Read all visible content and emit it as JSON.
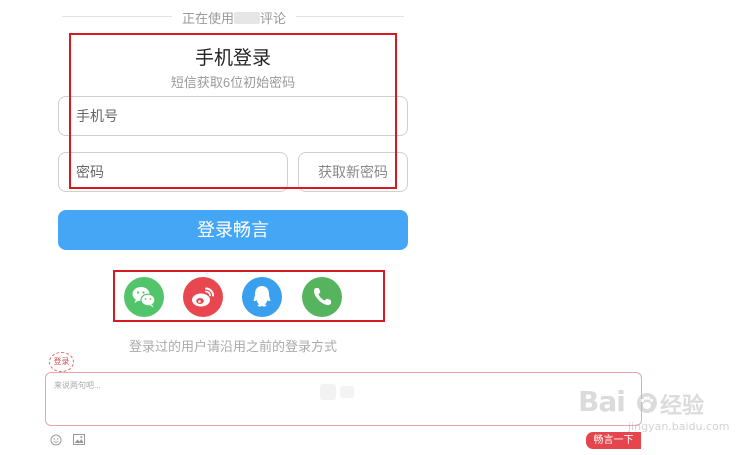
{
  "header": {
    "prefix": "正在使用",
    "suffix": "评论"
  },
  "login": {
    "title": "手机登录",
    "subtitle": "短信获取6位初始密码",
    "phone_placeholder": "手机号",
    "password_placeholder": "密码",
    "get_password_label": "获取新密码",
    "submit_label": "登录畅言"
  },
  "social": {
    "icons": [
      "wechat-icon",
      "weibo-icon",
      "qq-icon",
      "phone-icon"
    ],
    "colors": {
      "wechat": "#52c46a",
      "weibo": "#e9474f",
      "qq": "#3aa0ee",
      "phone": "#57b45e"
    }
  },
  "hint": "登录过的用户请沿用之前的登录方式",
  "comment": {
    "badge": "登录",
    "placeholder": "来说两句吧...",
    "submit_label": "畅言一下",
    "tools": [
      "emoji-icon",
      "image-icon"
    ]
  },
  "watermark": {
    "brand": "Bai",
    "brand_cn": "经验",
    "url": "jingyan.baidu.com"
  },
  "colors": {
    "accent": "#44a6f5",
    "highlight": "#d71920",
    "submit": "#e5464d"
  }
}
